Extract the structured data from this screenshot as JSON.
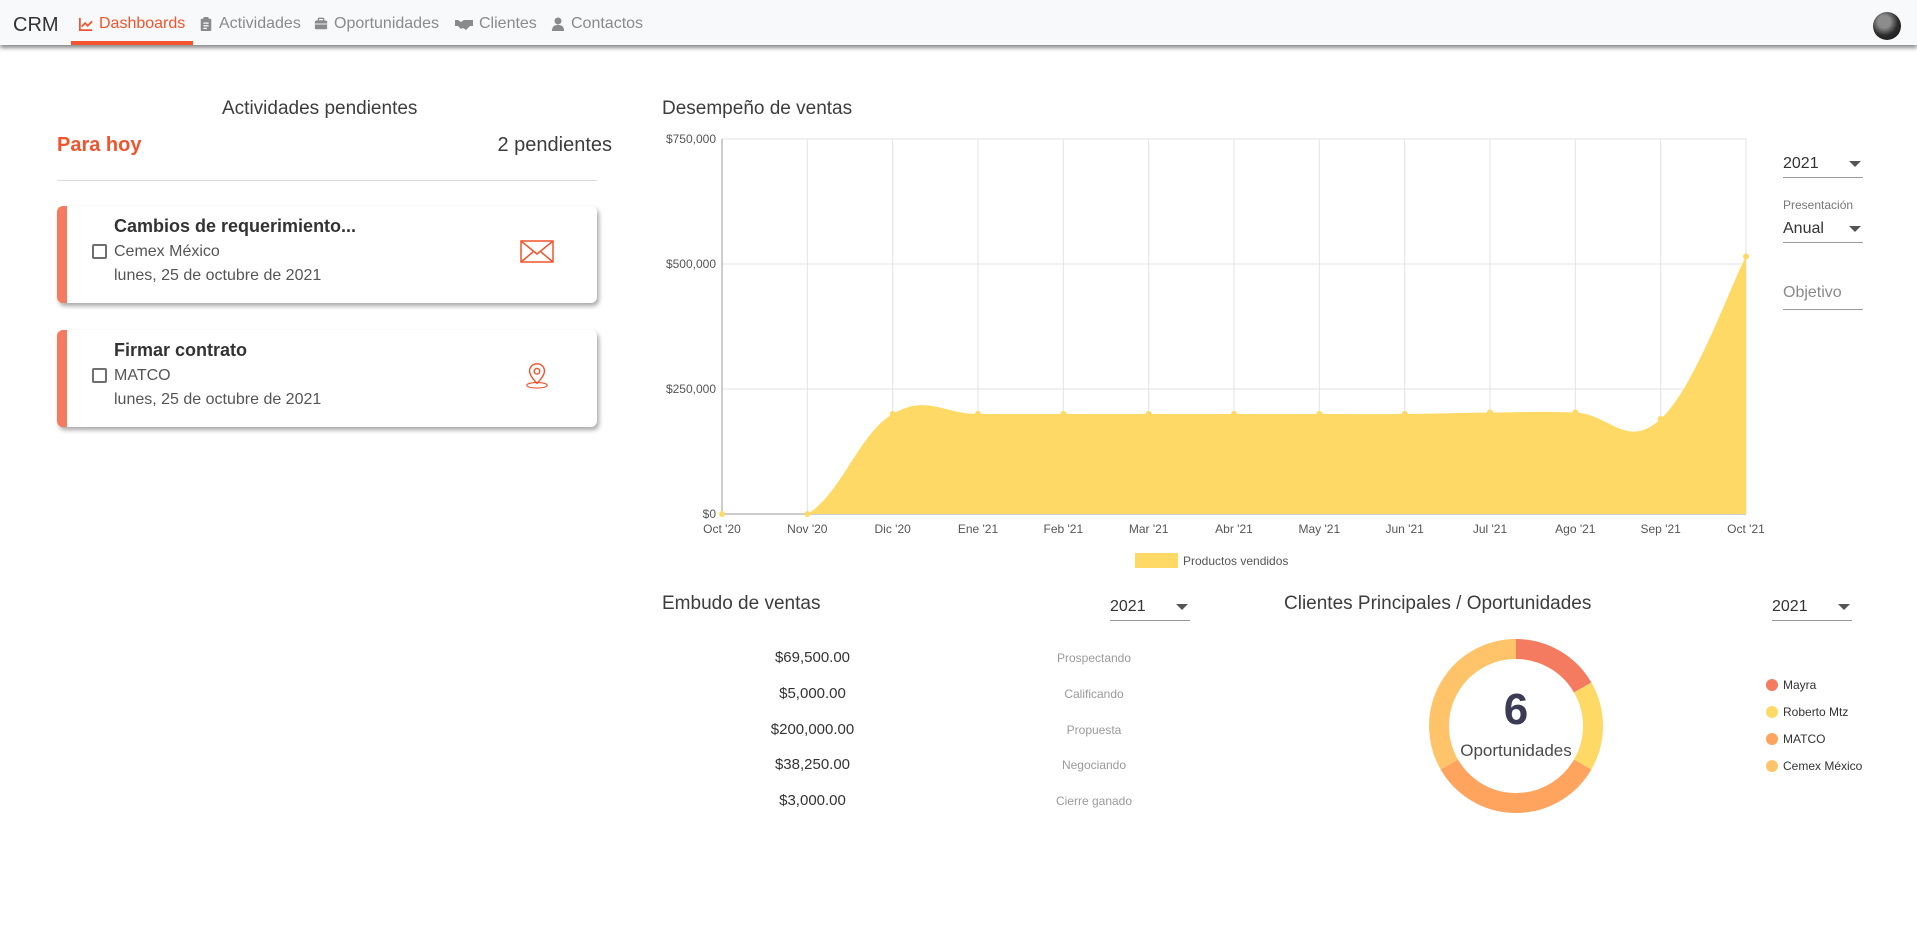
{
  "app": {
    "brand": "CRM",
    "nav": [
      {
        "label": "Dashboards",
        "icon": "chart-line-icon"
      },
      {
        "label": "Actividades",
        "icon": "clipboard-icon"
      },
      {
        "label": "Oportunidades",
        "icon": "briefcase-icon"
      },
      {
        "label": "Clientes",
        "icon": "handshake-icon"
      },
      {
        "label": "Contactos",
        "icon": "user-icon"
      }
    ]
  },
  "actividades": {
    "title": "Actividades pendientes",
    "filter": "Para hoy",
    "count": "2 pendientes",
    "items": [
      {
        "title": "Cambios de requerimiento...",
        "company": "Cemex México",
        "date": "lunes, 25 de octubre de 2021",
        "icon": "envelope-icon"
      },
      {
        "title": "Firmar contrato",
        "company": "MATCO",
        "date": "lunes, 25 de octubre de 2021",
        "icon": "map-pin-icon"
      }
    ]
  },
  "desempeno": {
    "title": "Desempeño de ventas",
    "year_select": "2021",
    "presentacion_label": "Presentación",
    "presentacion_value": "Anual",
    "objetivo_placeholder": "Objetivo"
  },
  "chart_data": {
    "type": "area",
    "title": "Desempeño de ventas",
    "x": [
      "Oct '20",
      "Nov '20",
      "Dic '20",
      "Ene '21",
      "Feb '21",
      "Mar '21",
      "Abr '21",
      "May '21",
      "Jun '21",
      "Jul '21",
      "Ago '21",
      "Sep '21",
      "Oct '21"
    ],
    "series": [
      {
        "name": "Productos vendidos",
        "values": [
          0,
          0,
          200000,
          200000,
          200000,
          200000,
          200000,
          200000,
          200000,
          203000,
          203000,
          190000,
          515000
        ],
        "color": "#ffd966"
      }
    ],
    "yticks": [
      "$0",
      "$250,000",
      "$500,000",
      "$750,000"
    ],
    "ylim": [
      0,
      750000
    ],
    "grid": true,
    "legend": "bottom"
  },
  "embudo": {
    "title": "Embudo de ventas",
    "year_select": "2021",
    "stages": [
      {
        "amount": "$69,500.00",
        "stage": "Prospectando",
        "color": "#fff06a"
      },
      {
        "amount": "$5,000.00",
        "stage": "Calificando",
        "color": "#ffda6a"
      },
      {
        "amount": "$200,000.00",
        "stage": "Propuesta",
        "color": "#ffc46a"
      },
      {
        "amount": "$38,250.00",
        "stage": "Negociando",
        "color": "#ffa45e"
      },
      {
        "amount": "$3,000.00",
        "stage": "Cierre ganado",
        "color": "#ff8566"
      }
    ]
  },
  "clientes": {
    "title": "Clientes Principales / Oportunidades",
    "year_select": "2021",
    "total": "6",
    "total_label": "Oportunidades",
    "legend": [
      {
        "name": "Mayra",
        "color": "#f47b5f",
        "count": 1
      },
      {
        "name": "Roberto Mtz",
        "color": "#ffd966",
        "count": 1
      },
      {
        "name": "MATCO",
        "color": "#ffa45e",
        "count": 2
      },
      {
        "name": "Cemex México",
        "color": "#ffc46a",
        "count": 2
      }
    ]
  }
}
